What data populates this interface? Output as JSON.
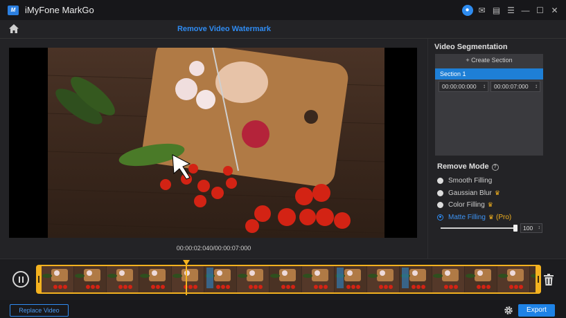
{
  "app": {
    "title": "iMyFone MarkGo",
    "logo_text": "M"
  },
  "window_controls": {
    "icons": [
      "user-icon",
      "mail-icon",
      "feedback-icon",
      "menu-icon",
      "minimize-icon",
      "maximize-icon",
      "close-icon"
    ]
  },
  "header": {
    "title": "Remove Video Watermark",
    "home_icon": "home-icon"
  },
  "player": {
    "timecode": "00:00:02:040/00:00:07:000"
  },
  "segmentation": {
    "title": "Video Segmentation",
    "create_label": "+ Create Section",
    "sections": [
      {
        "label": "Section 1",
        "start": "00:00:00:000",
        "end": "00:00:07:000"
      }
    ]
  },
  "remove_mode": {
    "title": "Remove Mode",
    "help_icon": "help-icon",
    "options": [
      {
        "label": "Smooth Filling",
        "premium": false,
        "selected": false
      },
      {
        "label": "Gaussian Blur",
        "premium": true,
        "selected": false
      },
      {
        "label": "Color Filling",
        "premium": true,
        "selected": false
      },
      {
        "label": "Matte Filling",
        "premium": true,
        "pro": "(Pro)",
        "selected": true
      }
    ],
    "slider_value": "100"
  },
  "timeline": {
    "play_state": "pause",
    "progress_fraction": 0.29
  },
  "footer": {
    "replace_label": "Replace Video",
    "export_label": "Export"
  },
  "colors": {
    "accent": "#2f8cf3",
    "premium": "#f4b21f",
    "selected_row": "#1e7fd6"
  }
}
